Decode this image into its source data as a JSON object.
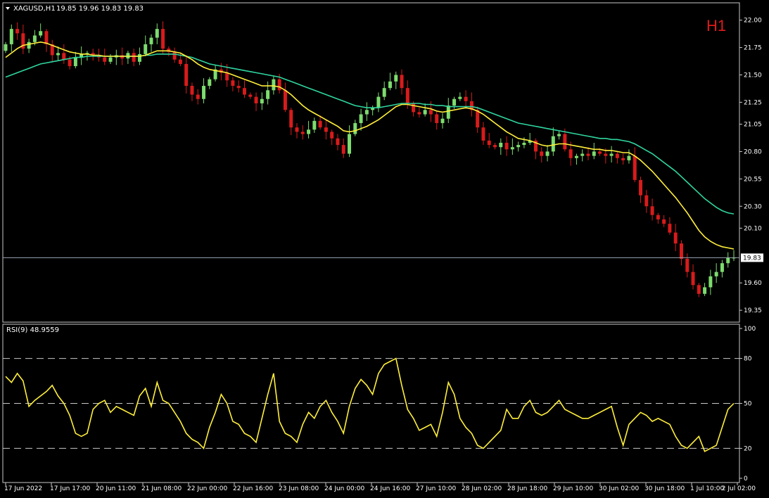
{
  "header": {
    "symbol_text": "XAGUSD,H1",
    "ohlc_text": "19.85 19.96 19.83 19.83"
  },
  "timeframe_badge": "H1",
  "colors": {
    "background": "#000000",
    "bull_candle": "#7ddc6e",
    "bear_candle": "#d81b1b",
    "ma_fast": "#ffef3a",
    "ma_slow": "#2fd6a0",
    "rsi_line": "#ffef3a",
    "grid_dash": "#c8c8c8",
    "frame": "#c8c8c8",
    "price_line": "#9aa6b2"
  },
  "chart_data": [
    {
      "type": "candlestick",
      "title": "XAGUSD,H1",
      "y_ticks": [
        "22.00",
        "21.75",
        "21.50",
        "21.25",
        "21.05",
        "20.80",
        "20.55",
        "20.30",
        "20.10",
        "19.60",
        "19.35"
      ],
      "ylim": [
        19.28,
        22.12
      ],
      "current_price_label": "19.83",
      "current_price": 19.83,
      "series": [
        {
          "name": "close",
          "values": [
            21.78,
            21.92,
            21.88,
            21.74,
            21.8,
            21.86,
            21.9,
            21.78,
            21.68,
            21.7,
            21.64,
            21.58,
            21.66,
            21.69,
            21.7,
            21.68,
            21.66,
            21.62,
            21.66,
            21.68,
            21.65,
            21.7,
            21.62,
            21.69,
            21.78,
            21.84,
            21.92,
            21.74,
            21.71,
            21.64,
            21.6,
            21.4,
            21.32,
            21.28,
            21.4,
            21.46,
            21.55,
            21.52,
            21.45,
            21.4,
            21.38,
            21.32,
            21.3,
            21.24,
            21.28,
            21.36,
            21.46,
            21.36,
            21.18,
            21.02,
            20.98,
            20.96,
            21.0,
            21.08,
            21.02,
            20.98,
            20.92,
            20.86,
            20.78,
            20.96,
            21.06,
            21.14,
            21.18,
            21.2,
            21.3,
            21.38,
            21.44,
            21.5,
            21.38,
            21.24,
            21.16,
            21.14,
            21.18,
            21.14,
            21.06,
            21.1,
            21.22,
            21.28,
            21.3,
            21.26,
            21.18,
            21.02,
            20.9,
            20.86,
            20.84,
            20.88,
            20.82,
            20.84,
            20.86,
            20.88,
            20.9,
            20.8,
            20.76,
            20.8,
            20.94,
            20.96,
            20.82,
            20.74,
            20.76,
            20.78,
            20.76,
            20.8,
            20.78,
            20.76,
            20.78,
            20.74,
            20.72,
            20.76,
            20.54,
            20.4,
            20.3,
            20.22,
            20.18,
            20.14,
            20.06,
            19.96,
            19.82,
            19.7,
            19.58,
            19.5,
            19.56,
            19.66,
            19.7,
            19.78,
            19.83,
            19.83
          ]
        },
        {
          "name": "ma_fast",
          "values": [
            21.66,
            21.7,
            21.74,
            21.77,
            21.78,
            21.79,
            21.8,
            21.79,
            21.77,
            21.75,
            21.73,
            21.71,
            21.7,
            21.69,
            21.69,
            21.68,
            21.68,
            21.67,
            21.67,
            21.67,
            21.67,
            21.67,
            21.67,
            21.67,
            21.68,
            21.7,
            21.72,
            21.72,
            21.72,
            21.71,
            21.7,
            21.67,
            21.64,
            21.6,
            21.57,
            21.55,
            21.54,
            21.53,
            21.52,
            21.5,
            21.48,
            21.46,
            21.44,
            21.42,
            21.4,
            21.4,
            21.4,
            21.39,
            21.36,
            21.32,
            21.27,
            21.22,
            21.18,
            21.15,
            21.12,
            21.09,
            21.06,
            21.03,
            20.99,
            20.98,
            20.99,
            21.01,
            21.03,
            21.06,
            21.09,
            21.13,
            21.17,
            21.21,
            21.23,
            21.23,
            21.22,
            21.21,
            21.2,
            21.19,
            21.17,
            21.16,
            21.17,
            21.18,
            21.19,
            21.2,
            21.19,
            21.17,
            21.14,
            21.1,
            21.06,
            21.02,
            20.98,
            20.95,
            20.92,
            20.91,
            20.9,
            20.88,
            20.86,
            20.85,
            20.86,
            20.87,
            20.87,
            20.86,
            20.85,
            20.84,
            20.83,
            20.82,
            20.82,
            20.81,
            20.81,
            20.8,
            20.79,
            20.79,
            20.76,
            20.72,
            20.67,
            20.62,
            20.56,
            20.5,
            20.44,
            20.38,
            20.31,
            20.24,
            20.16,
            20.08,
            20.02,
            19.98,
            19.95,
            19.93,
            19.92,
            19.91
          ]
        },
        {
          "name": "ma_slow",
          "values": [
            21.48,
            21.5,
            21.52,
            21.54,
            21.56,
            21.58,
            21.6,
            21.61,
            21.62,
            21.63,
            21.64,
            21.65,
            21.66,
            21.66,
            21.67,
            21.67,
            21.67,
            21.67,
            21.67,
            21.67,
            21.67,
            21.67,
            21.67,
            21.67,
            21.68,
            21.68,
            21.69,
            21.69,
            21.69,
            21.69,
            21.68,
            21.67,
            21.66,
            21.64,
            21.62,
            21.6,
            21.59,
            21.58,
            21.57,
            21.56,
            21.55,
            21.54,
            21.53,
            21.52,
            21.51,
            21.5,
            21.49,
            21.48,
            21.46,
            21.44,
            21.42,
            21.4,
            21.38,
            21.36,
            21.34,
            21.32,
            21.3,
            21.28,
            21.26,
            21.24,
            21.22,
            21.21,
            21.2,
            21.2,
            21.2,
            21.21,
            21.22,
            21.23,
            21.24,
            21.24,
            21.24,
            21.24,
            21.23,
            21.23,
            21.22,
            21.22,
            21.21,
            21.21,
            21.21,
            21.21,
            21.21,
            21.2,
            21.18,
            21.16,
            21.14,
            21.12,
            21.1,
            21.08,
            21.06,
            21.05,
            21.04,
            21.03,
            21.02,
            21.01,
            21.0,
            20.99,
            20.98,
            20.97,
            20.96,
            20.95,
            20.94,
            20.93,
            20.92,
            20.92,
            20.91,
            20.91,
            20.9,
            20.89,
            20.87,
            20.84,
            20.81,
            20.78,
            20.74,
            20.7,
            20.66,
            20.62,
            20.57,
            20.52,
            20.47,
            20.42,
            20.37,
            20.33,
            20.29,
            20.26,
            20.24,
            20.23
          ]
        }
      ],
      "x_tick_labels": [
        "17 Jun 2022",
        "17 Jun 17:00",
        "20 Jun 11:00",
        "21 Jun 08:00",
        "22 Jun 00:00",
        "22 Jun 16:00",
        "23 Jun 08:00",
        "24 Jun 00:00",
        "24 Jun 16:00",
        "27 Jun 10:00",
        "28 Jun 02:00",
        "28 Jun 18:00",
        "29 Jun 10:00",
        "30 Jun 02:00",
        "30 Jun 18:00",
        "1 Jul 10:00",
        "2 Jul 02:00"
      ]
    },
    {
      "type": "line",
      "title": "RSI(9) 48.9559",
      "y_ticks": [
        "100",
        "80",
        "50",
        "20",
        "0"
      ],
      "ylim": [
        0,
        100
      ],
      "levels": [
        80,
        50,
        20
      ],
      "series": [
        {
          "name": "RSI(9)",
          "values": [
            68,
            64,
            70,
            65,
            48,
            52,
            55,
            58,
            62,
            55,
            50,
            42,
            30,
            28,
            30,
            46,
            50,
            52,
            44,
            48,
            46,
            44,
            42,
            55,
            60,
            48,
            64,
            52,
            50,
            44,
            38,
            30,
            26,
            24,
            20,
            34,
            44,
            56,
            50,
            38,
            36,
            30,
            28,
            24,
            40,
            56,
            70,
            38,
            30,
            28,
            24,
            36,
            44,
            40,
            48,
            52,
            44,
            38,
            30,
            48,
            60,
            66,
            62,
            56,
            70,
            76,
            78,
            80,
            62,
            46,
            40,
            32,
            34,
            36,
            28,
            44,
            64,
            56,
            40,
            34,
            30,
            22,
            20,
            24,
            28,
            32,
            46,
            40,
            40,
            48,
            52,
            44,
            42,
            44,
            48,
            52,
            46,
            44,
            42,
            40,
            40,
            42,
            44,
            46,
            48,
            34,
            22,
            36,
            40,
            44,
            42,
            38,
            40,
            38,
            36,
            28,
            22,
            20,
            24,
            28,
            18,
            20,
            22,
            34,
            46,
            50
          ]
        }
      ]
    }
  ]
}
